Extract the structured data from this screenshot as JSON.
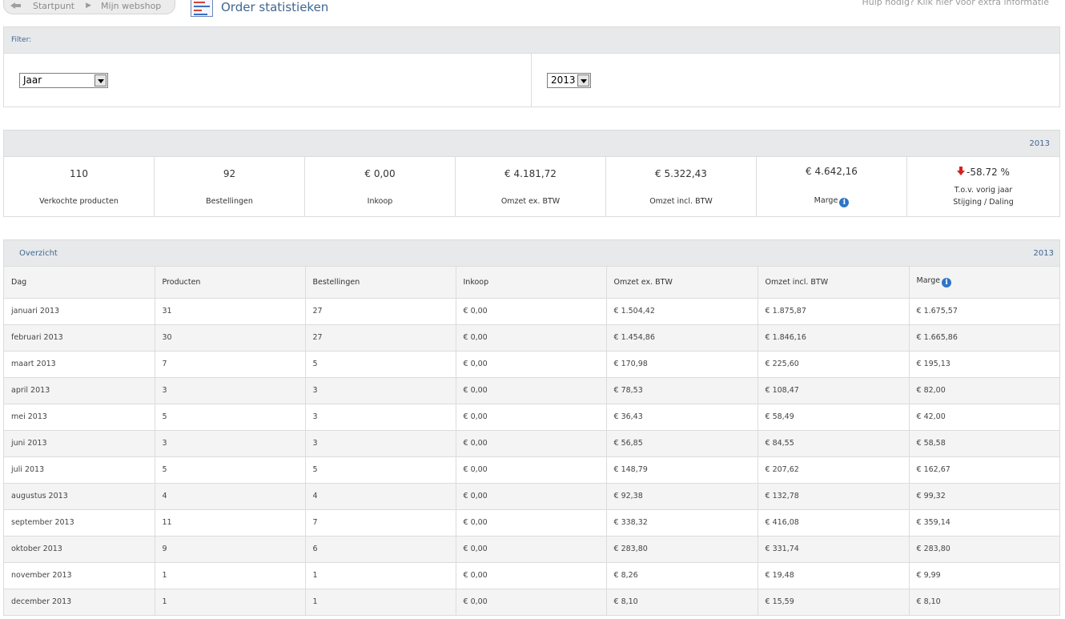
{
  "breadcrumb": {
    "home": "Startpunt",
    "current": "Mijn webshop"
  },
  "page": {
    "title": "Order statistieken",
    "help": "Hulp nodig? Klik hier voor extra informatie"
  },
  "filter": {
    "label": "Filter:",
    "period_value": "Jaar",
    "year_value": "2013"
  },
  "summary": {
    "year": "2013",
    "stats": [
      {
        "value": "110",
        "label": "Verkochte producten"
      },
      {
        "value": "92",
        "label": "Bestellingen"
      },
      {
        "value": "€ 0,00",
        "label": "Inkoop"
      },
      {
        "value": "€ 4.181,72",
        "label": "Omzet ex. BTW"
      },
      {
        "value": "€ 5.322,43",
        "label": "Omzet incl. BTW"
      },
      {
        "value": "€ 4.642,16",
        "label": "Marge"
      }
    ],
    "change": {
      "value": "-58.72 %",
      "label_line1": "T.o.v. vorig jaar",
      "label_line2": "Stijging / Daling"
    }
  },
  "overview": {
    "title": "Overzicht",
    "year": "2013",
    "columns": [
      "Dag",
      "Producten",
      "Bestellingen",
      "Inkoop",
      "Omzet ex. BTW",
      "Omzet incl. BTW",
      "Marge"
    ],
    "rows": [
      [
        "januari 2013",
        "31",
        "27",
        "€ 0,00",
        "€ 1.504,42",
        "€ 1.875,87",
        "€ 1.675,57"
      ],
      [
        "februari 2013",
        "30",
        "27",
        "€ 0,00",
        "€ 1.454,86",
        "€ 1.846,16",
        "€ 1.665,86"
      ],
      [
        "maart 2013",
        "7",
        "5",
        "€ 0,00",
        "€ 170,98",
        "€ 225,60",
        "€ 195,13"
      ],
      [
        "april 2013",
        "3",
        "3",
        "€ 0,00",
        "€ 78,53",
        "€ 108,47",
        "€ 82,00"
      ],
      [
        "mei 2013",
        "5",
        "3",
        "€ 0,00",
        "€ 36,43",
        "€ 58,49",
        "€ 42,00"
      ],
      [
        "juni 2013",
        "3",
        "3",
        "€ 0,00",
        "€ 56,85",
        "€ 84,55",
        "€ 58,58"
      ],
      [
        "juli 2013",
        "5",
        "5",
        "€ 0,00",
        "€ 148,79",
        "€ 207,62",
        "€ 162,67"
      ],
      [
        "augustus 2013",
        "4",
        "4",
        "€ 0,00",
        "€ 92,38",
        "€ 132,78",
        "€ 99,32"
      ],
      [
        "september 2013",
        "11",
        "7",
        "€ 0,00",
        "€ 338,32",
        "€ 416,08",
        "€ 359,14"
      ],
      [
        "oktober 2013",
        "9",
        "6",
        "€ 0,00",
        "€ 283,80",
        "€ 331,74",
        "€ 283,80"
      ],
      [
        "november 2013",
        "1",
        "1",
        "€ 0,00",
        "€ 8,26",
        "€ 19,48",
        "€ 9,99"
      ],
      [
        "december 2013",
        "1",
        "1",
        "€ 0,00",
        "€ 8,10",
        "€ 15,59",
        "€ 8,10"
      ]
    ]
  }
}
